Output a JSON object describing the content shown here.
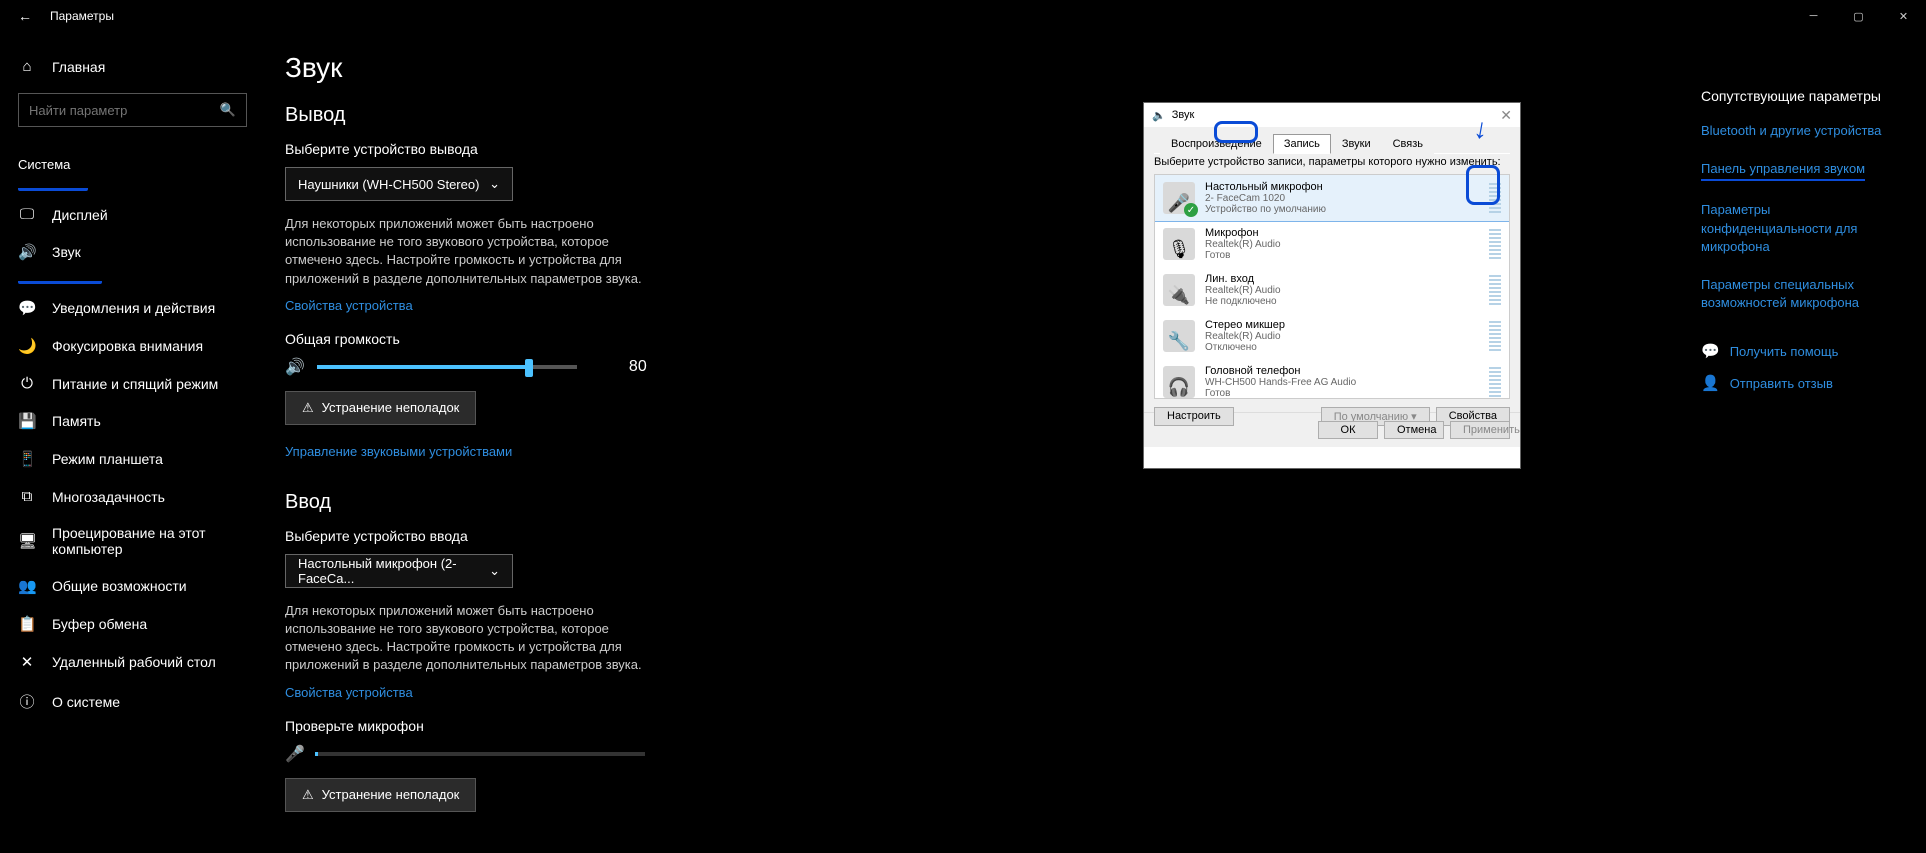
{
  "titlebar": {
    "back": "←",
    "title": "Параметры"
  },
  "sidebar": {
    "home": "Главная",
    "search_placeholder": "Найти параметр",
    "section": "Система",
    "items": [
      {
        "icon": "🖵",
        "label": "Дисплей"
      },
      {
        "icon": "🔊",
        "label": "Звук"
      },
      {
        "icon": "💬",
        "label": "Уведомления и действия"
      },
      {
        "icon": "🌙",
        "label": "Фокусировка внимания"
      },
      {
        "icon": "⏻",
        "label": "Питание и спящий режим"
      },
      {
        "icon": "💾",
        "label": "Память"
      },
      {
        "icon": "📱",
        "label": "Режим планшета"
      },
      {
        "icon": "⧉",
        "label": "Многозадачность"
      },
      {
        "icon": "🖥",
        "label": "Проецирование на этот компьютер"
      },
      {
        "icon": "👥",
        "label": "Общие возможности"
      },
      {
        "icon": "📋",
        "label": "Буфер обмена"
      },
      {
        "icon": "✕",
        "label": "Удаленный рабочий стол"
      },
      {
        "icon": "ⓘ",
        "label": "О системе"
      }
    ]
  },
  "main": {
    "title": "Звук",
    "output": {
      "heading": "Вывод",
      "select_label": "Выберите устройство вывода",
      "select_value": "Наушники (WH-CH500 Stereo)",
      "help": "Для некоторых приложений может быть настроено использование не того звукового устройства, которое отмечено здесь. Настройте громкость и устройства для приложений в разделе дополнительных параметров звука.",
      "props_link": "Свойства устройства",
      "volume_label": "Общая громкость",
      "volume_value": "80",
      "troubleshoot": "Устранение неполадок",
      "manage_link": "Управление звуковыми устройствами"
    },
    "input": {
      "heading": "Ввод",
      "select_label": "Выберите устройство ввода",
      "select_value": "Настольный микрофон (2- FaceCa...",
      "help": "Для некоторых приложений может быть настроено использование не того звукового устройства, которое отмечено здесь. Настройте громкость и устройства для приложений в разделе дополнительных параметров звука.",
      "props_link": "Свойства устройства",
      "test_label": "Проверьте микрофон",
      "troubleshoot": "Устранение неполадок"
    }
  },
  "rail": {
    "heading": "Сопутствующие параметры",
    "links": [
      "Bluetooth и другие устройства",
      "Панель управления звуком",
      "Параметры конфиденциальности для микрофона",
      "Параметры специальных возможностей микрофона"
    ],
    "help": "Получить помощь",
    "feedback": "Отправить отзыв"
  },
  "dialog": {
    "title": "Звук",
    "tabs": [
      "Воспроизведение",
      "Запись",
      "Звуки",
      "Связь"
    ],
    "instruction": "Выберите устройство записи, параметры которого нужно изменить:",
    "devices": [
      {
        "name": "Настольный микрофон",
        "sub1": "2- FaceCam 1020",
        "sub2": "Устройство по умолчанию",
        "check": true,
        "icon": "🎤"
      },
      {
        "name": "Микрофон",
        "sub1": "Realtek(R) Audio",
        "sub2": "Готов",
        "check": false,
        "icon": "🎙"
      },
      {
        "name": "Лин. вход",
        "sub1": "Realtek(R) Audio",
        "sub2": "Не подключено",
        "check": false,
        "icon": "🔌"
      },
      {
        "name": "Стерео микшер",
        "sub1": "Realtek(R) Audio",
        "sub2": "Отключено",
        "check": false,
        "icon": "🔧"
      },
      {
        "name": "Головной телефон",
        "sub1": "WH-CH500 Hands-Free AG Audio",
        "sub2": "Готов",
        "check": false,
        "icon": "🎧"
      }
    ],
    "btn_configure": "Настроить",
    "btn_default": "По умолчанию",
    "btn_props": "Свойства",
    "ok": "ОК",
    "cancel": "Отмена",
    "apply": "Применить"
  }
}
